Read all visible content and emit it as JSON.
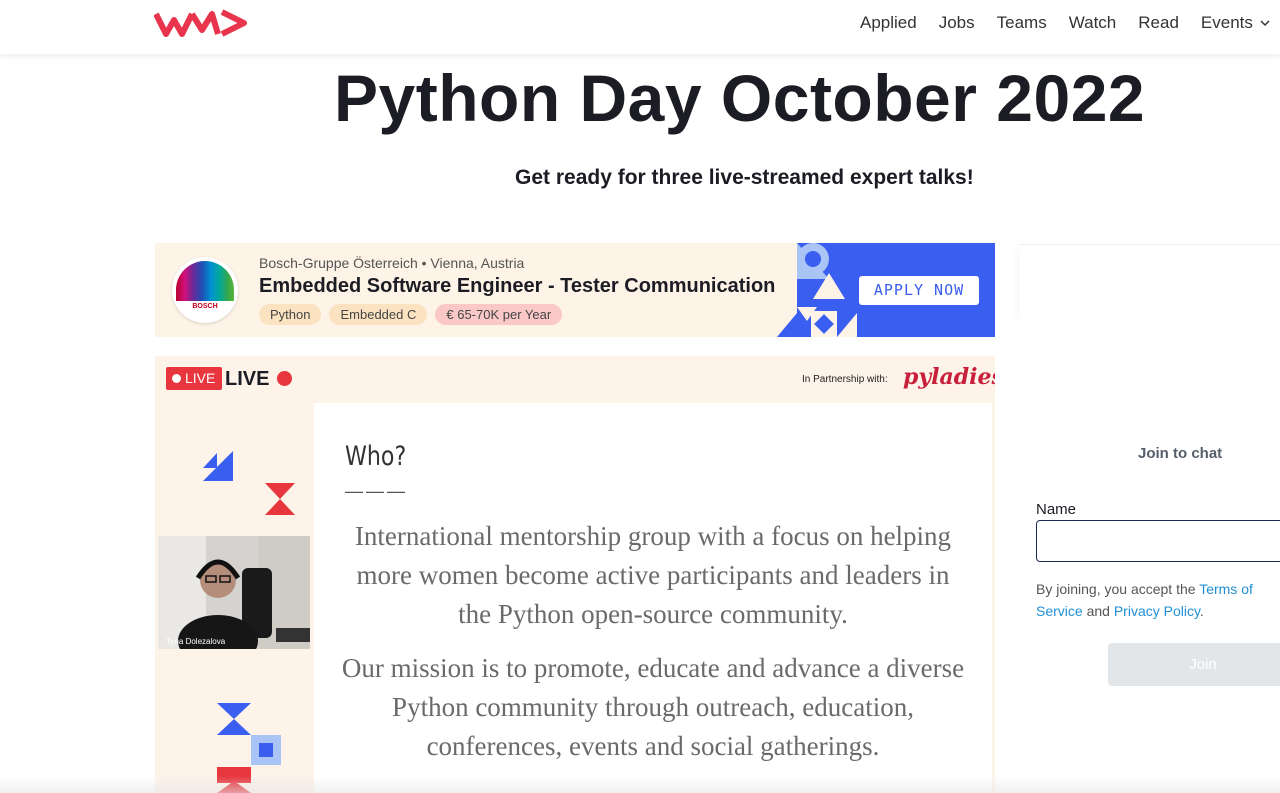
{
  "nav": {
    "links": [
      "Applied",
      "Jobs",
      "Teams",
      "Watch",
      "Read",
      "Events"
    ]
  },
  "hero": {
    "title": "Python Day October 2022",
    "subtitle": "Get ready for three live-streamed expert talks!"
  },
  "job": {
    "logo_text": "BOSCH",
    "company": "Bosch-Gruppe Österreich",
    "separator": "•",
    "location": "Vienna, Austria",
    "title": "Embedded Software Engineer - Tester Communication",
    "tags": [
      "Python",
      "Embedded C"
    ],
    "salary": "€ 65-70K per Year",
    "apply_label": "APPLY NOW",
    "apply_color": "#3a5ef0",
    "art_color": "#3a5ef0"
  },
  "stream": {
    "live_badge": "LIVE",
    "live_text": "LIVE",
    "partner_label": "In Partnership with:",
    "partner_name": "pyladies",
    "who_title": "Who?",
    "who_dash": "———",
    "paragraph1": "International mentorship group with a focus on helping more women become active participants and leaders in the Python open-source community.",
    "paragraph2": "Our mission is to promote, educate and advance a diverse Python community through outreach, education, conferences, events and social gatherings.",
    "speaker_name": "Tyna Dolezalova",
    "accent_red": "#e7363e",
    "accent_blue": "#3a5ef0"
  },
  "chat": {
    "title": "Join to chat",
    "name_label": "Name",
    "name_value": "",
    "terms_prefix": "By joining, you accept the ",
    "terms_link": "Terms of Service",
    "terms_and": " and ",
    "privacy_link": "Privacy Policy",
    "terms_suffix": ".",
    "join_label": "Join"
  }
}
